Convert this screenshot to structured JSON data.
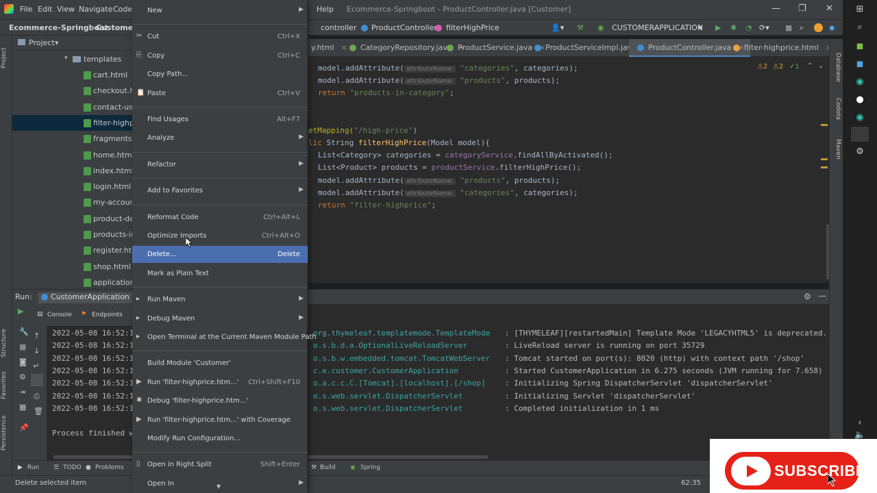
{
  "window": {
    "title": "Ecommerce-Springboot - ProductController.java [Customer]",
    "menu": [
      "File",
      "Edit",
      "View",
      "Navigate",
      "Code",
      "Help"
    ]
  },
  "navbar": {
    "project": "Ecommerce-Springboot",
    "module": "Customer",
    "path": [
      "controller",
      "ProductController",
      "filterHighPrice"
    ],
    "run_config": "CUSTOMERAPPLICATION"
  },
  "project_panel": {
    "title": "Project",
    "folder": "templates",
    "files": [
      "cart.html",
      "checkout.htm",
      "contact-us.ht",
      "filter-highpri",
      "fragments.htr",
      "home.html",
      "index.html",
      "login.html",
      "my-account.l",
      "product-deta",
      "products-in-c",
      "register.html",
      "shop.html",
      "application.prop"
    ],
    "selected_index": 3
  },
  "editor_tabs": [
    {
      "label": "y.html",
      "color": "#e8a33d"
    },
    {
      "label": "CategoryRepository.java",
      "color": "#6aa84f"
    },
    {
      "label": "ProductService.java",
      "color": "#6aa84f"
    },
    {
      "label": "ProductServiceImpl.java",
      "color": "#3d8fd1"
    },
    {
      "label": "ProductController.java",
      "color": "#3d8fd1",
      "active": true
    },
    {
      "label": "filter-highprice.html",
      "color": "#e8a33d"
    }
  ],
  "inspections": {
    "warn": "2",
    "weak": "2",
    "typo": "1"
  },
  "code": {
    "hint": "attributeName:",
    "lines": [
      {
        "pre": "model.addAttribute(",
        "s": "\"categories\"",
        "post": ", categories);"
      },
      {
        "pre": "model.addAttribute(",
        "s": "\"products\"",
        "post": ", products);"
      },
      {
        "kw": "return ",
        "s": "\"products-in-category\"",
        "post": ";"
      },
      {
        "ann": "etMapping(",
        "s": "\"/high-price\"",
        "post": ")"
      },
      {
        "kw": "lic ",
        "type": "String ",
        "fn": "filterHighPrice",
        "post": "(Model model){"
      },
      {
        "type": "List<Category> categories = ",
        "fld": "categoryService",
        "post": ".findAllByActivated();"
      },
      {
        "type": "List<Product> products = ",
        "fld": "productService",
        "post": ".filterHighPrice();"
      },
      {
        "pre": "model.addAttribute(",
        "s": "\"products\"",
        "post": ", products);"
      },
      {
        "pre": "model.addAttribute(",
        "s": "\"categories\"",
        "post": ", categories);"
      },
      {
        "kw": "return ",
        "s": "\"filter-highprice\"",
        "post": ";"
      }
    ]
  },
  "run_panel": {
    "label": "Run:",
    "config": "CustomerApplication",
    "tabs": [
      "Console",
      "Endpoints"
    ],
    "timestamps": [
      "2022-05-08 16:52:1",
      "2022-05-08 16:52:1",
      "2022-05-08 16:52:1",
      "2022-05-08 16:52:1",
      "2022-05-08 16:52:1",
      "2022-05-08 16:52:1",
      "2022-05-08 16:52:1"
    ],
    "process_line": "Process finished w",
    "log": [
      {
        "logger": "org.thymeleaf.templatemode.TemplateMode",
        "msg": ": [THYMELEAF][restartedMain] Template Mode 'LEGACYHTML5' is deprecated."
      },
      {
        "logger": "o.s.b.d.a.OptionalLiveReloadServer",
        "msg": ": LiveReload server is running on port 35729"
      },
      {
        "logger": "o.s.b.w.embedded.tomcat.TomcatWebServer",
        "msg": ": Tomcat started on port(s): 8020 (http) with context path '/shop'"
      },
      {
        "logger": "c.e.customer.CustomerApplication",
        "msg": ": Started CustomerApplication in 6.275 seconds (JVM running for 7.658)"
      },
      {
        "logger": "o.a.c.c.C.[Tomcat].[localhost].[/shop]",
        "msg": ": Initializing Spring DispatcherServlet 'dispatcherServlet'"
      },
      {
        "logger": "o.s.web.servlet.DispatcherServlet",
        "msg": ": Initializing Servlet 'dispatcherServlet'"
      },
      {
        "logger": "o.s.web.servlet.DispatcherServlet",
        "msg": ": Completed initialization in 1 ms"
      }
    ]
  },
  "bottom_tabs": [
    "Run",
    "TODO",
    "Problems",
    "Build",
    "Spring"
  ],
  "side_tabs": {
    "left": [
      "Project",
      "Structure",
      "Favorites",
      "Persistence"
    ],
    "right": [
      "Database",
      "Codota",
      "Maven"
    ]
  },
  "status": {
    "message": "Delete selected item",
    "position": "62:35"
  },
  "context_menu": [
    {
      "label": "New",
      "submenu": true
    },
    {
      "sep": true
    },
    {
      "label": "Cut",
      "shortcut": "Ctrl+X",
      "icon": "✂"
    },
    {
      "label": "Copy",
      "shortcut": "Ctrl+C",
      "icon": "⎘"
    },
    {
      "label": "Copy Path..."
    },
    {
      "label": "Paste",
      "shortcut": "Ctrl+V",
      "icon": "📋"
    },
    {
      "sep": true
    },
    {
      "label": "Find Usages",
      "shortcut": "Alt+F7"
    },
    {
      "label": "Analyze",
      "submenu": true
    },
    {
      "sep": true
    },
    {
      "label": "Refactor",
      "submenu": true
    },
    {
      "sep": true
    },
    {
      "label": "Add to Favorites",
      "submenu": true
    },
    {
      "sep": true
    },
    {
      "label": "Reformat Code",
      "shortcut": "Ctrl+Alt+L"
    },
    {
      "label": "Optimize Imports",
      "shortcut": "Ctrl+Alt+O"
    },
    {
      "label": "Delete...",
      "shortcut": "Delete",
      "highlighted": true
    },
    {
      "label": "Mark as Plain Text"
    },
    {
      "sep": true
    },
    {
      "label": "Run Maven",
      "submenu": true,
      "icon": "▸"
    },
    {
      "label": "Debug Maven",
      "submenu": true,
      "icon": "▸"
    },
    {
      "label": "Open Terminal at the Current Maven Module Path",
      "icon": "▸"
    },
    {
      "sep": true
    },
    {
      "label": "Build Module 'Customer'"
    },
    {
      "label": "Run 'filter-highprice.htm...'",
      "shortcut": "Ctrl+Shift+F10",
      "icon": "▶"
    },
    {
      "label": "Debug 'filter-highprice.htm...'",
      "icon": "✱"
    },
    {
      "label": "Run 'filter-highprice.htm...' with Coverage",
      "icon": "▶"
    },
    {
      "label": "Modify Run Configuration..."
    },
    {
      "sep": true
    },
    {
      "label": "Open in Right Split",
      "shortcut": "Shift+Enter",
      "icon": "▯"
    },
    {
      "label": "Open In",
      "submenu": true
    }
  ],
  "overlay": {
    "subscribe_label": "SUBSCRIBE"
  }
}
